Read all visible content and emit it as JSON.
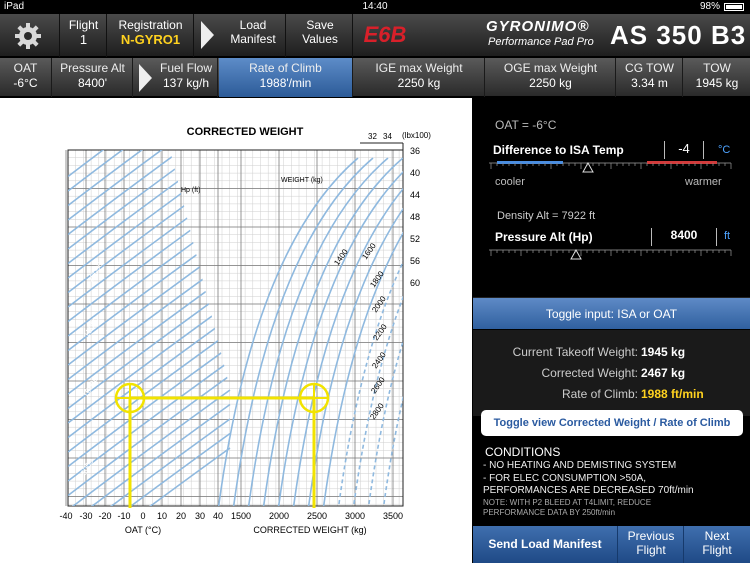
{
  "status": {
    "carrier": "iPad",
    "time": "14:40",
    "battery": "98%"
  },
  "toolbar": {
    "flight_label": "Flight",
    "flight_value": "1",
    "registration_label": "Registration",
    "registration_value": "N-GYRO1",
    "load_manifest": "Load Manifest",
    "save_values": "Save Values",
    "logo_text": "E6B",
    "brand_name": "GYRONIMO®",
    "brand_sub": "Performance Pad Pro",
    "model": "AS 350 B3"
  },
  "params": {
    "oat_label": "OAT",
    "oat_value": "-6°C",
    "palt_label": "Pressure Alt",
    "palt_value": "8400'",
    "fuel_label": "Fuel Flow",
    "fuel_value": "137 kg/h",
    "roc_label": "Rate of Climb",
    "roc_value": "1988'/min",
    "ige_label": "IGE max Weight",
    "ige_value": "2250 kg",
    "oge_label": "OGE max Weight",
    "oge_value": "2250 kg",
    "cg_label": "CG TOW",
    "cg_value": "3.34 m",
    "tow_label": "TOW",
    "tow_value": "1945 kg"
  },
  "chart": {
    "title": "CORRECTED WEIGHT",
    "hp_label": "Hp (ft)",
    "weight_label": "WEIGHT (kg)",
    "xlabel_left": "OAT (°C)",
    "xlabel_right": "CORRECTED WEIGHT (kg)",
    "top_unit": "(lbx100)",
    "top_ticks": [
      "32",
      "34"
    ],
    "oat_ticks": [
      "-40",
      "-30",
      "-20",
      "-10",
      "0",
      "10",
      "20",
      "30",
      "40"
    ],
    "weight_ticks": [
      "1500",
      "2000",
      "2500",
      "3000",
      "3500"
    ],
    "lb_ticks": [
      "36",
      "40",
      "44",
      "48",
      "52",
      "56",
      "60"
    ],
    "hp_curve_labels": [
      "20000",
      "15000",
      "10000",
      "5000",
      "0"
    ],
    "weight_curve_labels": [
      "1400",
      "1600",
      "1800",
      "2000",
      "2200",
      "2400",
      "2600",
      "2800"
    ],
    "accent_line": "#f2e300",
    "curve_color": "#8fb9df"
  },
  "right": {
    "oat_text": "OAT =  -6°C",
    "diff_title": "Difference to ISA Temp",
    "diff_value": "-4",
    "diff_unit": "°C",
    "cooler": "cooler",
    "warmer": "warmer",
    "density_alt": "Density Alt =  7922 ft",
    "pres_title": "Pressure Alt (Hp)",
    "pres_value": "8400",
    "pres_unit": "ft",
    "toggle_isa": "Toggle input: ISA or OAT",
    "current_tow_label": "Current Takeoff Weight:",
    "current_tow_value": "1945 kg",
    "corrected_label": "Corrected Weight:",
    "corrected_value": "2467 kg",
    "roc_label": "Rate of Climb:",
    "roc_value": "1988 ft/min",
    "toggle_view": "Toggle view Corrected Weight / Rate of Climb",
    "conditions_title": "CONDITIONS",
    "cond1": "- NO HEATING AND DEMISTING SYSTEM",
    "cond2": "- FOR ELEC CONSUMPTION >50A,",
    "cond3": "  PERFORMANCES ARE DECREASED 70ft/min",
    "note1": "  NOTE: WITH P2 BLEED AT T4LIMIT, REDUCE",
    "note2": "  PERFORMANCE DATA BY 250ft/min",
    "send": "Send Load Manifest",
    "prev": "Previous Flight",
    "next": "Next Flight"
  }
}
